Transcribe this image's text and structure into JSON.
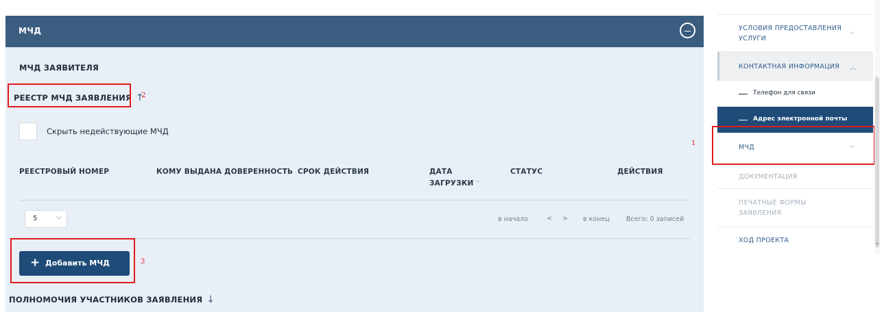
{
  "panel": {
    "title": "МЧД",
    "applicant_title": "МЧД ЗАЯВИТЕЛЯ",
    "registry_title": "РЕЕСТР МЧД ЗАЯВЛЕНИЯ",
    "registry_arrow": "↑",
    "hide_invalid_label": "Скрыть недействующие МЧД",
    "table": {
      "headers": {
        "registry_number": "РЕЕСТРОВЫЙ НОМЕР",
        "issued_to": "КОМУ ВЫДАНА ДОВЕРЕННОСТЬ",
        "validity": "СРОК ДЕЙСТВИЯ",
        "upload_date_1": "ДАТА",
        "upload_date_2": "ЗАГРУЗКИ",
        "status": "СТАТУС",
        "actions": "ДЕЙСТВИЯ"
      },
      "rows": []
    },
    "page_size": "5",
    "pager": {
      "first": "в начало",
      "prev": "<",
      "next": ">",
      "last": "в конец",
      "total": "Всего: 0 записей"
    },
    "add_button": "Добавить МЧД",
    "powers_title": "ПОЛНОМОЧИЯ УЧАСТНИКОВ ЗАЯВЛЕНИЯ",
    "powers_arrow": "↓"
  },
  "annotations": [
    "1",
    "2",
    "3"
  ],
  "sidebar": {
    "items": [
      {
        "label1": "УСЛОВИЯ ПРЕДОСТАВЛЕНИЯ",
        "label2": "УСЛУГИ",
        "expanded": false
      },
      {
        "label1": "КОНТАКТНАЯ ИНФОРМАЦИЯ",
        "expanded": true
      },
      {
        "label1": "МЧД",
        "expanded": false
      },
      {
        "label1": "ДОКУМЕНТАЦИЯ"
      },
      {
        "label1": "ПЕЧАТНЫЕ ФОРМЫ",
        "label2": "ЗАЯВЛЕНИЯ"
      },
      {
        "label1": "ХОД ПРОЕКТА"
      }
    ],
    "subitems": [
      {
        "label": "Телефон для связи",
        "active": false
      },
      {
        "label": "Адрес электронной почты",
        "active": true
      }
    ]
  },
  "colors": {
    "header_bg": "#3b5d80",
    "panel_bg": "#e8eff7",
    "button_bg": "#1e4b78",
    "annotation_red": "#e21b1b",
    "sidebar_active_bg": "#1e4b78",
    "sidebar_link": "#2f5d8c"
  }
}
